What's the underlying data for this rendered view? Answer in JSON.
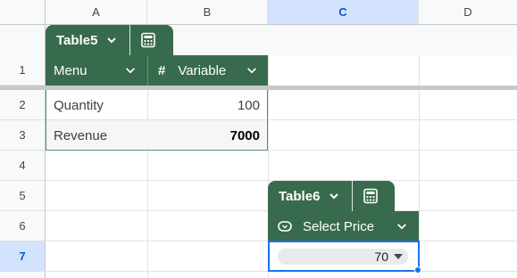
{
  "columns": [
    "A",
    "B",
    "C",
    "D"
  ],
  "rows": [
    "1",
    "2",
    "3",
    "4",
    "5",
    "6",
    "7"
  ],
  "selected_cell": {
    "column": "C",
    "row": "7"
  },
  "table5": {
    "name": "Table5",
    "headers": [
      {
        "label": "Menu",
        "type_icon": "text-column-icon"
      },
      {
        "label": "Variable",
        "type_icon": "number-column-icon",
        "type_glyph": "#"
      }
    ],
    "rows": [
      {
        "menu": "Quantity",
        "variable": "100"
      },
      {
        "menu": "Revenue",
        "variable": "7000"
      }
    ]
  },
  "table6": {
    "name": "Table6",
    "headers": [
      {
        "label": "Select Price",
        "type_icon": "dropdown-column-icon"
      }
    ],
    "rows": [
      {
        "select_price": "70"
      }
    ]
  },
  "colors": {
    "table_green": "#386b4d",
    "selection_blue": "#1a73e8",
    "selected_header_bg": "#d3e3fd",
    "dropdown_chip_bg": "#e8eaed"
  }
}
